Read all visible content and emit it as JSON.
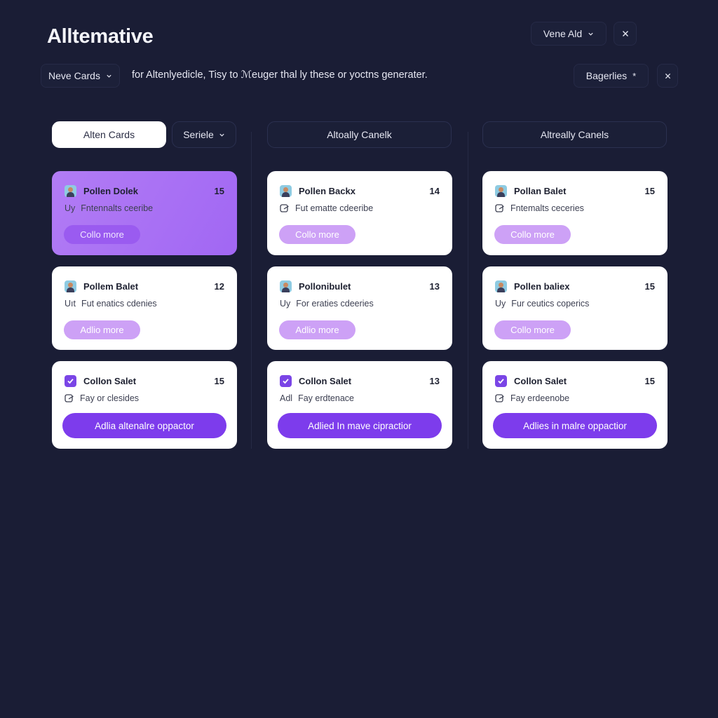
{
  "app": {
    "title": "Alltemative"
  },
  "header": {
    "view_select": "Vene Ald",
    "cards_select": "Neve Cards",
    "description": "for Altenlyedicle, Tisy to ℳeuger thal ly these or yoctns generater.",
    "categories_label": "Bagerlies",
    "categories_mark": "*"
  },
  "columns": [
    {
      "tab_label": "Alten Cards",
      "sort_label": "Seriele"
    },
    {
      "tab_label": "Altoally Canelk"
    },
    {
      "tab_label": "Altreally Canels"
    }
  ],
  "cards": [
    {
      "title": "Pollen Dolek",
      "count": "15",
      "sub_prefix": "Uy",
      "sub": "Fntennalts ceeribe",
      "button": "Collo more"
    },
    {
      "title": "Pollen Backx",
      "count": "14",
      "sub": "Fut ematte cdeeribe",
      "button": "Collo more"
    },
    {
      "title": "Pollan Balet",
      "count": "15",
      "sub": "Fntemalts ceceries",
      "button": "Collo more"
    },
    {
      "title": "Pollem Balet",
      "count": "12",
      "sub_prefix": "Uıt",
      "sub": "Fut enatics cdenies",
      "button": "Adlio more"
    },
    {
      "title": "Pollonibulet",
      "count": "13",
      "sub_prefix": "Uy",
      "sub": "For eraties cdeeries",
      "button": "Adlio more"
    },
    {
      "title": "Pollen baliex",
      "count": "15",
      "sub_prefix": "Uy",
      "sub": "Fur ceutics coperics",
      "button": "Collo more"
    },
    {
      "title": "Collon Salet",
      "count": "15",
      "sub": "Fay or clesides",
      "button": "Adlia altenalre oppactor"
    },
    {
      "title": "Collon Salet",
      "count": "13",
      "sub_prefix": "Adl",
      "sub": "Fay erdtenace",
      "button": "Adlied In mave cipractior"
    },
    {
      "title": "Collon Salet",
      "count": "15",
      "sub": "Fay erdeenobe",
      "button": "Adlies in malre oppactior"
    }
  ],
  "colors": {
    "background": "#1a1d35",
    "accent": "#7d3cec",
    "highlight_card": "#a96ff4",
    "pill": "#cda1f6"
  },
  "icons": [
    "chevron-down-icon",
    "close-icon",
    "avatar-icon",
    "checkbox-checked-icon",
    "note-icon"
  ]
}
